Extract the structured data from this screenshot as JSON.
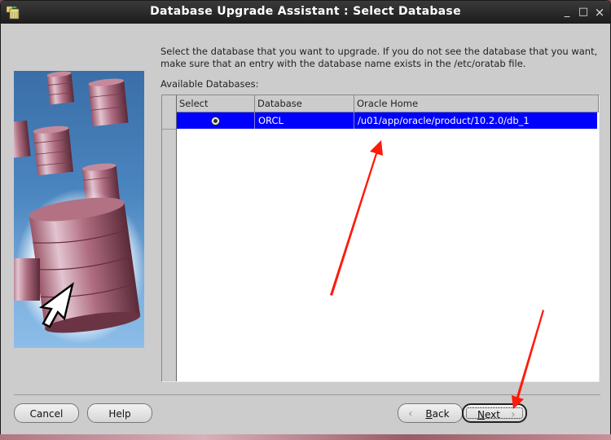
{
  "window": {
    "title": "Database Upgrade Assistant : Select Database",
    "controls": {
      "minimize": "_",
      "maximize": "□",
      "close": "×"
    },
    "app_icon": "oracle-dbua-icon"
  },
  "instructions": "Select the database that you want to upgrade. If you do not see the database that you want, make sure that an entry with the database name exists in the /etc/oratab file.",
  "available_label": "Available Databases:",
  "table": {
    "columns": [
      "Select",
      "Database",
      "Oracle Home"
    ],
    "rows": [
      {
        "selected": true,
        "database": "ORCL",
        "oracle_home": "/u01/app/oracle/product/10.2.0/db_1"
      }
    ]
  },
  "buttons": {
    "cancel": "Cancel",
    "help": "Help",
    "back": "Back",
    "back_mnemonic": "B",
    "back_rest": "ack",
    "next": "Next",
    "next_mnemonic": "N",
    "next_rest": "ext"
  },
  "colors": {
    "selection": "#0000ff",
    "annotation_arrow": "#ff1a0a",
    "dialog_bg": "#cccccc"
  }
}
